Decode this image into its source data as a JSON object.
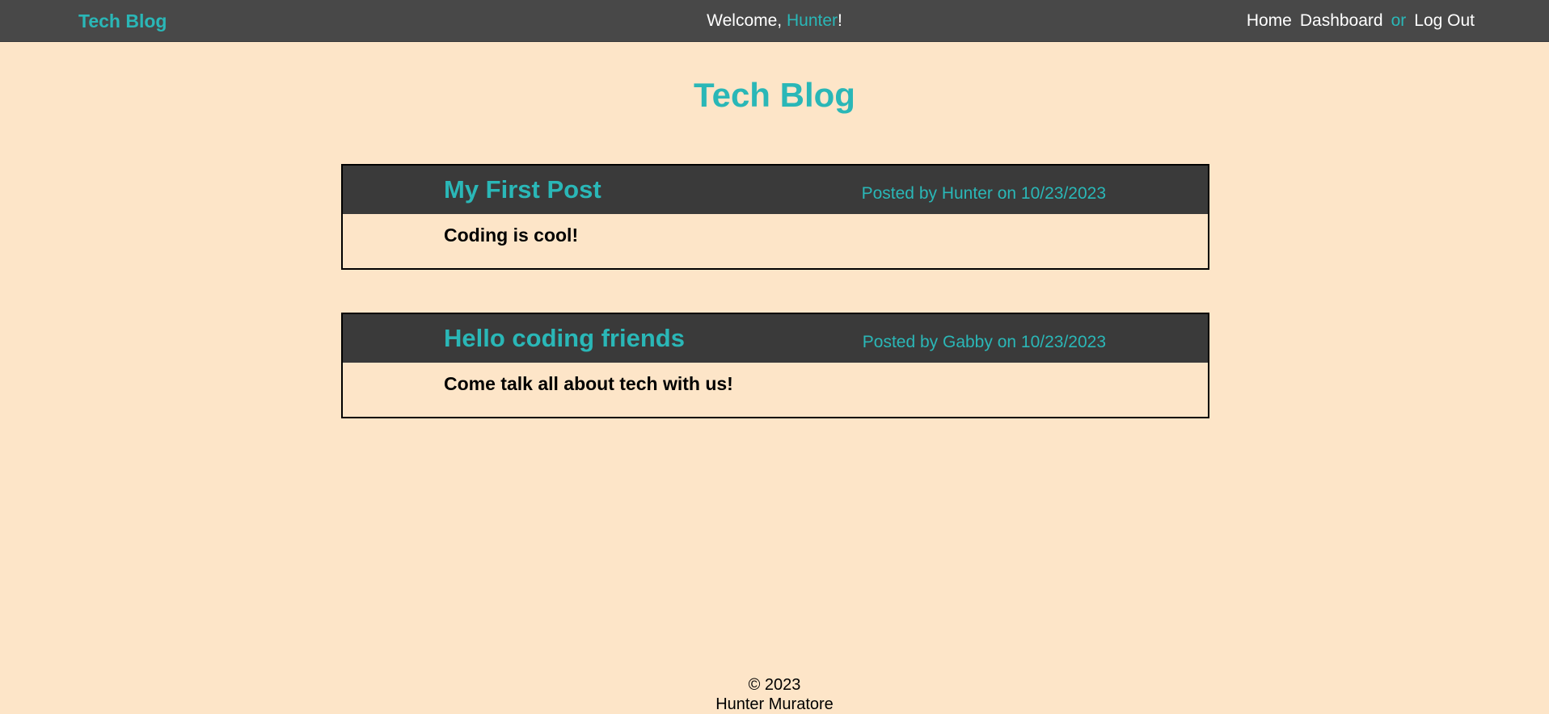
{
  "header": {
    "brand": "Tech Blog",
    "welcome_prefix": "Welcome, ",
    "username": "Hunter",
    "welcome_suffix": "!",
    "nav": {
      "home": "Home",
      "dashboard": "Dashboard",
      "or": "or",
      "logout": "Log Out"
    }
  },
  "main": {
    "title": "Tech Blog",
    "posts": [
      {
        "title": "My First Post",
        "meta": "Posted by Hunter on 10/23/2023",
        "body": "Coding is cool!"
      },
      {
        "title": "Hello coding friends",
        "meta": "Posted by Gabby on 10/23/2023",
        "body": "Come talk all about tech with us!"
      }
    ]
  },
  "footer": {
    "copyright": "© 2023",
    "author": "Hunter Muratore"
  },
  "colors": {
    "accent": "#2ab7b7",
    "background": "#fde5c8",
    "topbar": "#484848",
    "post_header": "#3a3a3a"
  }
}
